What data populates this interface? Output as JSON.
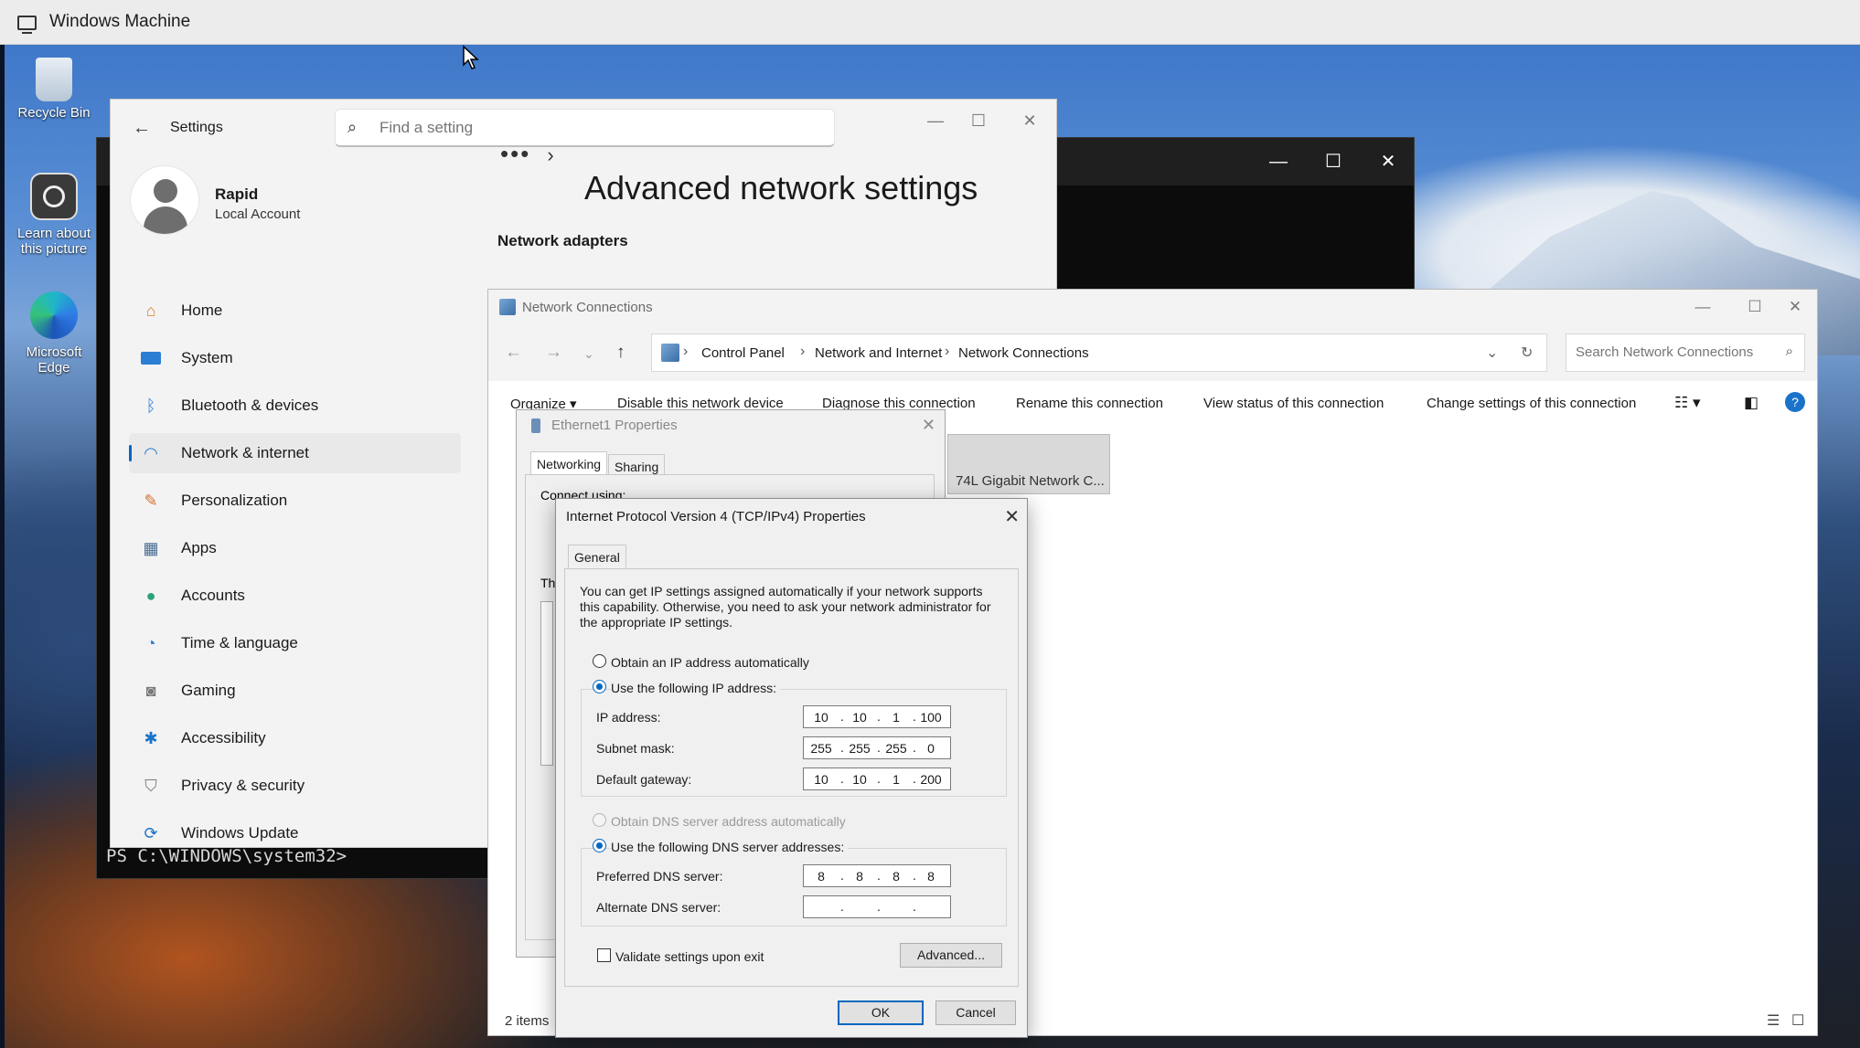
{
  "host": {
    "title": "Windows Machine"
  },
  "desktop": {
    "icons": [
      {
        "label": "Recycle Bin"
      },
      {
        "label": "Learn about this picture"
      },
      {
        "label": "Microsoft Edge"
      }
    ]
  },
  "console": {
    "prompt": "PS C:\\WINDOWS\\system32>"
  },
  "settings": {
    "app_title": "Settings",
    "search_placeholder": "Find a setting",
    "user": {
      "name": "Rapid",
      "account_type": "Local Account"
    },
    "nav": [
      {
        "label": "Home",
        "icon": "home-icon",
        "color": "#d9822b"
      },
      {
        "label": "System",
        "icon": "system-icon",
        "color": "#2a7fd4"
      },
      {
        "label": "Bluetooth & devices",
        "icon": "bluetooth-icon",
        "color": "#2a7fd4"
      },
      {
        "label": "Network & internet",
        "icon": "wifi-icon",
        "color": "#2a7fd4",
        "selected": true
      },
      {
        "label": "Personalization",
        "icon": "brush-icon",
        "color": "#d86d2c"
      },
      {
        "label": "Apps",
        "icon": "apps-icon",
        "color": "#4a6d95"
      },
      {
        "label": "Accounts",
        "icon": "accounts-icon",
        "color": "#2aa37a"
      },
      {
        "label": "Time & language",
        "icon": "globe-clock-icon",
        "color": "#2a7fd4"
      },
      {
        "label": "Gaming",
        "icon": "gamepad-icon",
        "color": "#7a7a7a"
      },
      {
        "label": "Accessibility",
        "icon": "accessibility-icon",
        "color": "#1a73c9"
      },
      {
        "label": "Privacy & security",
        "icon": "shield-icon",
        "color": "#7a7a7a"
      },
      {
        "label": "Windows Update",
        "icon": "update-icon",
        "color": "#1a73c9"
      }
    ],
    "breadcrumb_ellipsis": "•••",
    "page_title": "Advanced network settings",
    "section_heading": "Network adapters"
  },
  "netconn": {
    "title": "Network Connections",
    "address": [
      "Control Panel",
      "Network and Internet",
      "Network Connections"
    ],
    "search_placeholder": "Search Network Connections",
    "commands": [
      "Organize ▾",
      "Disable this network device",
      "Diagnose this connection",
      "Rename this connection",
      "View status of this connection",
      "Change settings of this connection"
    ],
    "adapter_label": "74L Gigabit Network C...",
    "status": "2 items"
  },
  "ethernet_props": {
    "title": "Ethernet1 Properties",
    "tabs": [
      "Networking",
      "Sharing"
    ],
    "connect_using_partial": "Connect using:",
    "th_partial": "Th"
  },
  "ipv4": {
    "title": "Internet Protocol Version 4 (TCP/IPv4) Properties",
    "tab": "General",
    "description": "You can get IP settings assigned automatically if your network supports this capability. Otherwise, you need to ask your network administrator for the appropriate IP settings.",
    "obtain_ip_auto": "Obtain an IP address automatically",
    "use_following_ip": "Use the following IP address:",
    "ip_label": "IP address:",
    "ip": [
      "10",
      "10",
      "1",
      "100"
    ],
    "subnet_label": "Subnet mask:",
    "subnet": [
      "255",
      "255",
      "255",
      "0"
    ],
    "gateway_label": "Default gateway:",
    "gateway": [
      "10",
      "10",
      "1",
      "200"
    ],
    "obtain_dns_auto": "Obtain DNS server address automatically",
    "use_following_dns": "Use the following DNS server addresses:",
    "preferred_label": "Preferred DNS server:",
    "preferred": [
      "8",
      "8",
      "8",
      "8"
    ],
    "alternate_label": "Alternate DNS server:",
    "alternate": [
      "",
      "",
      "",
      ""
    ],
    "validate_label": "Validate settings upon exit",
    "advanced_label": "Advanced...",
    "ok_label": "OK",
    "cancel_label": "Cancel"
  }
}
